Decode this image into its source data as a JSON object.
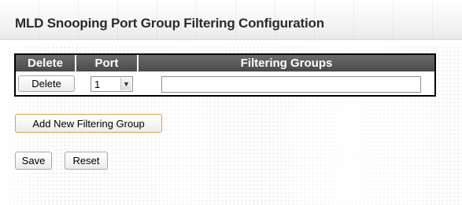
{
  "page": {
    "title": "MLD Snooping Port Group Filtering Configuration"
  },
  "table": {
    "headers": [
      "Delete",
      "Port",
      "Filtering Groups"
    ],
    "rows": [
      {
        "delete_label": "Delete",
        "port_value": "1",
        "filtering_groups_value": ""
      }
    ]
  },
  "actions": {
    "add_label": "Add New Filtering Group",
    "save_label": "Save",
    "reset_label": "Reset"
  },
  "icons": {
    "select_arrow": "chevron-down-icon"
  }
}
